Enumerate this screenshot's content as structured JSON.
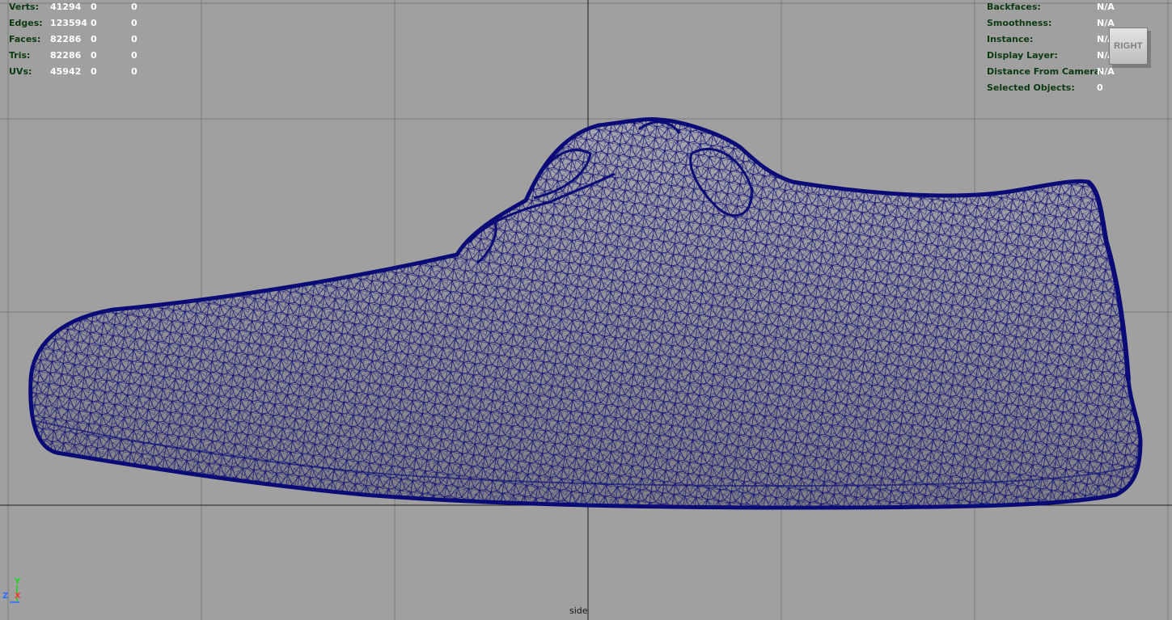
{
  "hud_left": {
    "rows": [
      {
        "label": "Verts:",
        "values": [
          "41294",
          "0",
          "0"
        ]
      },
      {
        "label": "Edges:",
        "values": [
          "123594",
          "0",
          "0"
        ]
      },
      {
        "label": "Faces:",
        "values": [
          "82286",
          "0",
          "0"
        ]
      },
      {
        "label": "Tris:",
        "values": [
          "82286",
          "0",
          "0"
        ]
      },
      {
        "label": "UVs:",
        "values": [
          "45942",
          "0",
          "0"
        ]
      }
    ]
  },
  "hud_right": {
    "rows": [
      {
        "label": "Backfaces:",
        "value": "N/A"
      },
      {
        "label": "Smoothness:",
        "value": "N/A"
      },
      {
        "label": "Instance:",
        "value": "N/A"
      },
      {
        "label": "Display Layer:",
        "value": "N/A"
      },
      {
        "label": "Distance From Camera:",
        "value": "N/A"
      },
      {
        "label": "Selected Objects:",
        "value": "0"
      }
    ]
  },
  "view_cube": {
    "label": "RIGHT"
  },
  "camera": {
    "name": "side"
  },
  "axis": {
    "y": "Y",
    "z": "Z",
    "x": "X"
  },
  "colors": {
    "viewport_bg": "#a0a0a0",
    "grid_line": "#7a7a7a",
    "axis_line": "#1a1a1a",
    "wireframe": "#0b0b78",
    "shaded_fill": "#8c8c8c",
    "hud_label": "#0c3a10",
    "hud_value": "#ffffff"
  },
  "model": {
    "name": "shoe-mesh",
    "display": "wireframe-on-shaded"
  }
}
